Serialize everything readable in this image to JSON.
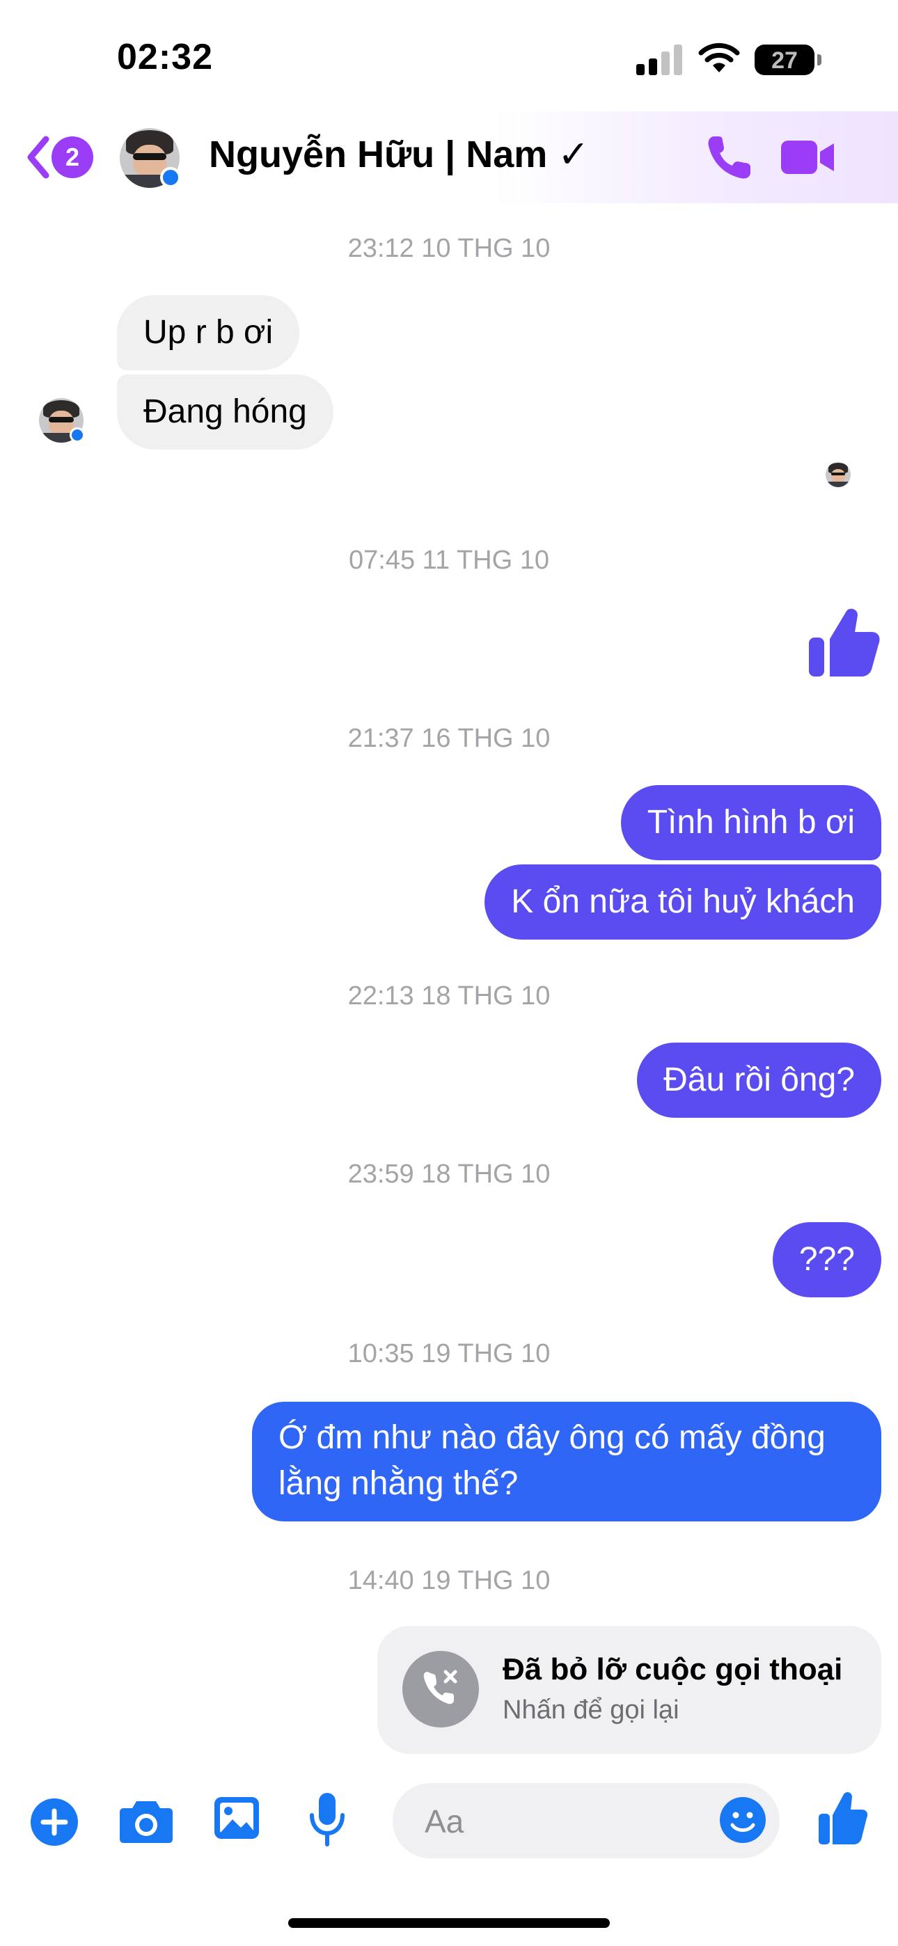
{
  "status_bar": {
    "time": "02:32",
    "battery": "27"
  },
  "header": {
    "unread_count": "2",
    "contact_name": "Nguyễn Hữu | Nam ✓"
  },
  "messages": [
    {
      "timestamp": "23:12 10 THG 10"
    },
    {
      "incoming_1": "Up r b ơi",
      "incoming_2": "Đang hóng"
    },
    {
      "timestamp": "07:45 11 THG 10"
    },
    {
      "timestamp": "21:37 16 THG 10",
      "outgoing_1": "Tình hình b ơi",
      "outgoing_2": "K ổn nữa tôi huỷ khách"
    },
    {
      "timestamp": "22:13 18 THG 10",
      "outgoing": "Đâu rồi ông?"
    },
    {
      "timestamp": "23:59 18 THG 10",
      "outgoing": "???"
    },
    {
      "timestamp": "10:35 19 THG 10",
      "outgoing_line1": "Ớ đm như nào đây ông có mấy đồng",
      "outgoing_line2": "lằng nhằng thế?"
    },
    {
      "timestamp": "14:40 19 THG 10",
      "missed_call_title": "Đã bỏ lỡ cuộc gọi thoại",
      "missed_call_subtitle": "Nhấn để gọi lại"
    }
  ],
  "composer": {
    "placeholder": "Aa"
  },
  "colors": {
    "accent_purple": "#9b3df6",
    "outgoing_bubble": "#5a4cf0",
    "outgoing_bubble_blue": "#2f66f5",
    "composer_icons": "#1877f2"
  }
}
